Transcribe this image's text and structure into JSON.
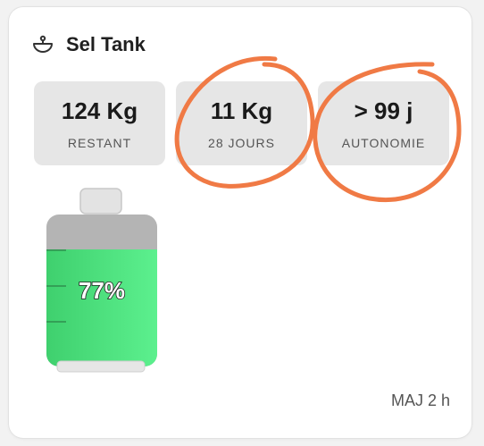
{
  "card": {
    "title": "Sel Tank",
    "title_icon": "scale-icon"
  },
  "stats": [
    {
      "value": "124 Kg",
      "label": "RESTANT"
    },
    {
      "value": "11 Kg",
      "label": "28 JOURS"
    },
    {
      "value": "> 99 j",
      "label": "AUTONOMIE"
    }
  ],
  "tank": {
    "level_percent": 77,
    "level_text": "77%",
    "fill_color": "#5cf08e",
    "empty_color": "#b4b4b4"
  },
  "footer": {
    "updated": "MAJ 2 h"
  },
  "annotation_color": "#f07a45"
}
